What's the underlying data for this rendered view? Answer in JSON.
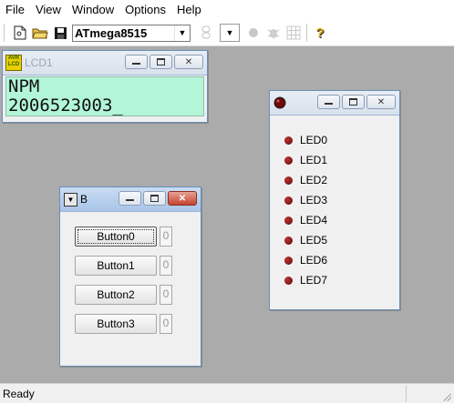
{
  "menu": [
    "File",
    "View",
    "Window",
    "Options",
    "Help"
  ],
  "toolbar": {
    "device": "ATmega8515",
    "help_icon": "?",
    "icons": [
      "new-file-icon",
      "open-folder-icon",
      "save-icon",
      "seven-segment-icon",
      "led-icon",
      "bug-icon",
      "grid-icon",
      "help-icon"
    ]
  },
  "lcd_window": {
    "badge_top": "AVR",
    "badge_bottom": "LCD",
    "title": "LCD1",
    "line1": "NPM",
    "line2": "2006523003_"
  },
  "led_window": {
    "leds": [
      "LED0",
      "LED1",
      "LED2",
      "LED3",
      "LED4",
      "LED5",
      "LED6",
      "LED7"
    ],
    "led_color": "#8a1414"
  },
  "button_window": {
    "title": "B",
    "buttons": [
      {
        "label": "Button0",
        "count": "0"
      },
      {
        "label": "Button1",
        "count": "0"
      },
      {
        "label": "Button2",
        "count": "0"
      },
      {
        "label": "Button3",
        "count": "0"
      }
    ]
  },
  "status": "Ready",
  "colors": {
    "workspace": "#ababab",
    "lcd_background": "#b3f5d8",
    "close_button": "#c3442f"
  }
}
